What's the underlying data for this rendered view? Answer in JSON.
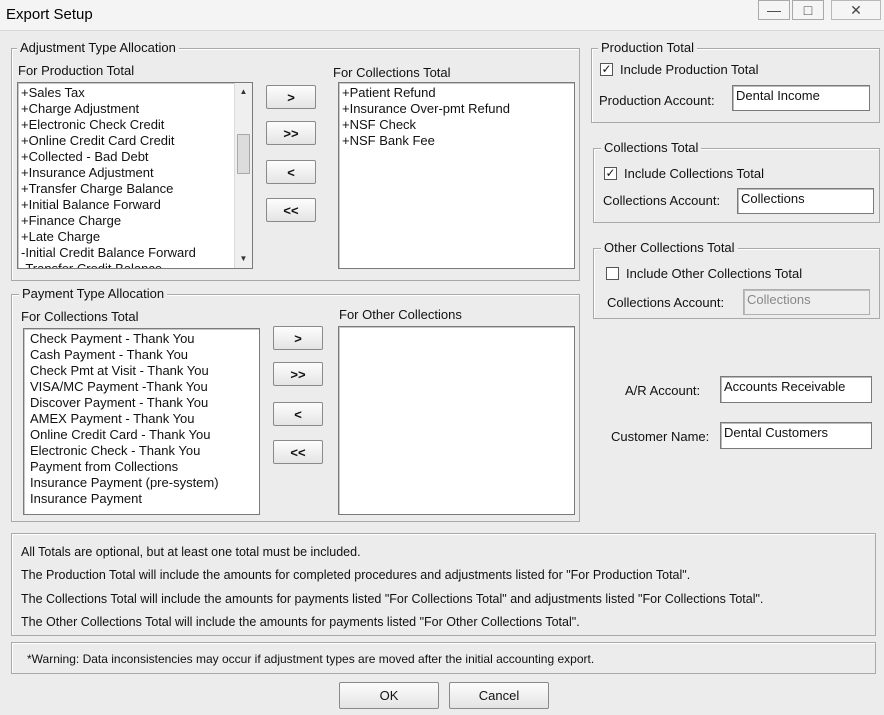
{
  "window": {
    "title": "Export Setup",
    "controls": {
      "minimize": "—",
      "maximize": "□",
      "close": "✕"
    }
  },
  "adjustment_group": {
    "legend": "Adjustment Type Allocation",
    "production_label": "For Production Total",
    "collections_label": "For Collections Total",
    "production_items": [
      "+Sales Tax",
      "+Charge Adjustment",
      "+Electronic Check Credit",
      "+Online Credit Card Credit",
      "+Collected - Bad Debt",
      "+Insurance Adjustment",
      "+Transfer Charge Balance",
      "+Initial Balance Forward",
      "+Finance Charge",
      "+Late Charge",
      "-Initial Credit Balance Forward",
      "-Transfer Credit Balance"
    ],
    "collections_items": [
      "+Patient Refund",
      "+Insurance Over-pmt Refund",
      "+NSF Check",
      "+NSF Bank Fee"
    ],
    "buttons": {
      "move_one": ">",
      "move_all": ">>",
      "remove_one": "<",
      "remove_all": "<<"
    },
    "scroll_position": 0.3
  },
  "payment_group": {
    "legend": "Payment Type Allocation",
    "collections_label": "For Collections Total",
    "other_label": "For Other Collections",
    "collections_items": [
      "Check Payment - Thank You",
      "Cash Payment - Thank You",
      "Check Pmt at Visit - Thank You",
      "VISA/MC Payment -Thank You",
      "Discover Payment - Thank You",
      "AMEX Payment - Thank You",
      "Online Credit Card - Thank You",
      "Electronic Check - Thank You",
      "Payment from Collections",
      "Insurance Payment (pre-system)",
      "Insurance Payment"
    ],
    "other_items": [],
    "buttons": {
      "move_one": ">",
      "move_all": ">>",
      "remove_one": "<",
      "remove_all": "<<"
    }
  },
  "production_total": {
    "legend": "Production Total",
    "checkbox_label": "Include Production Total",
    "checked": true,
    "account_label": "Production Account:",
    "account_value": "Dental Income"
  },
  "collections_total": {
    "legend": "Collections Total",
    "checkbox_label": "Include Collections Total",
    "checked": true,
    "account_label": "Collections Account:",
    "account_value": "Collections"
  },
  "other_collections_total": {
    "legend": "Other Collections Total",
    "checkbox_label": "Include Other Collections Total",
    "checked": false,
    "account_label": "Collections Account:",
    "account_value": "Collections"
  },
  "ar_account": {
    "label": "A/R Account:",
    "value": "Accounts Receivable"
  },
  "customer_name": {
    "label": "Customer Name:",
    "value": "Dental Customers"
  },
  "notes": [
    "All Totals are optional, but at least one total must be included.",
    "The Production Total will include the amounts for completed procedures and adjustments listed for \"For Production Total\".",
    "The Collections Total will include the amounts for payments listed \"For Collections Total\" and adjustments listed \"For Collections Total\".",
    "The Other Collections Total will include the amounts for payments listed \"For Other Collections Total\"."
  ],
  "warning": "*Warning: Data inconsistencies may occur if adjustment types are moved after the initial accounting export.",
  "footer": {
    "ok": "OK",
    "cancel": "Cancel"
  },
  "check_glyph": "✓"
}
